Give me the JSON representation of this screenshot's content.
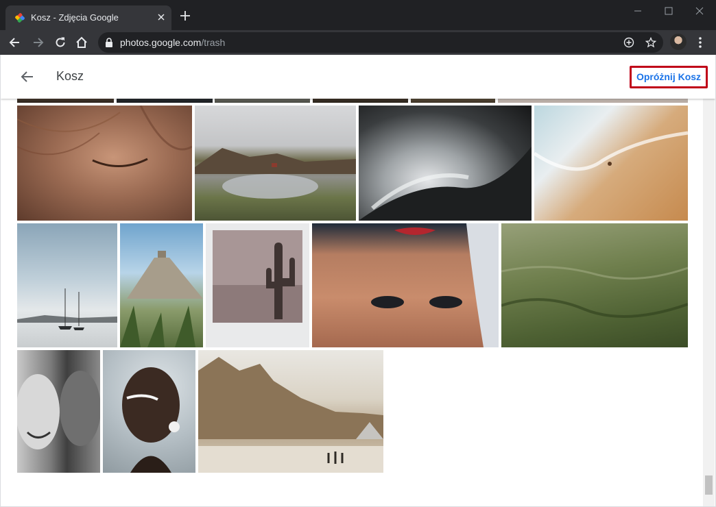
{
  "browser": {
    "tab_title": "Kosz - Zdjęcia Google",
    "url_host": "photos.google.com",
    "url_path": "/trash"
  },
  "appbar": {
    "title": "Kosz",
    "empty_trash_label": "Opróżnij Kosz"
  },
  "colors": {
    "accent": "#1a73e8",
    "highlight_border": "#c00018",
    "chrome_dark": "#202124",
    "chrome_toolbar": "#35363a"
  },
  "photos": [
    {
      "subject": "freckled-face-closeup"
    },
    {
      "subject": "mountain-lake-landscape"
    },
    {
      "subject": "crashing-wave"
    },
    {
      "subject": "beach-surf-aerial"
    },
    {
      "subject": "sailboats-on-lake"
    },
    {
      "subject": "mayan-pyramid"
    },
    {
      "subject": "cactus-polaroid"
    },
    {
      "subject": "upside-down-freckled-face"
    },
    {
      "subject": "green-grass-field"
    },
    {
      "subject": "black-white-couple-portrait"
    },
    {
      "subject": "woman-with-face-paint"
    },
    {
      "subject": "louvre-museum"
    }
  ]
}
